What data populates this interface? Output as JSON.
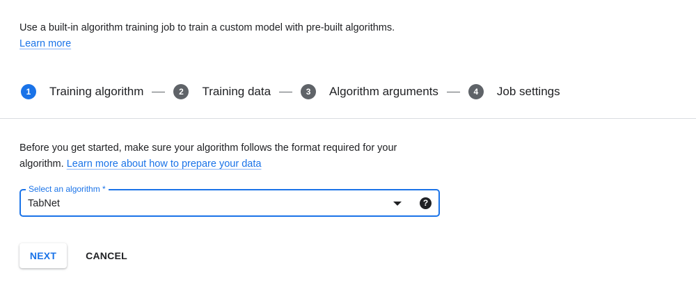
{
  "intro": {
    "text": "Use a built-in algorithm training job to train a custom model with pre-built algorithms.",
    "link": "Learn more"
  },
  "stepper": {
    "steps": [
      {
        "number": "1",
        "label": "Training algorithm",
        "active": true
      },
      {
        "number": "2",
        "label": "Training data",
        "active": false
      },
      {
        "number": "3",
        "label": "Algorithm arguments",
        "active": false
      },
      {
        "number": "4",
        "label": "Job settings",
        "active": false
      }
    ]
  },
  "description": {
    "text": "Before you get started, make sure your algorithm follows the format required for your algorithm.",
    "link": "Learn more about how to prepare your data"
  },
  "algorithm_select": {
    "label": "Select an algorithm *",
    "value": "TabNet",
    "dropdown_icon": "arrow-drop-down-icon",
    "help_icon": "help-icon",
    "help_glyph": "?"
  },
  "actions": {
    "next_label": "NEXT",
    "cancel_label": "CANCEL"
  },
  "colors": {
    "accent": "#1a73e8",
    "step_inactive": "#5f6368",
    "divider": "#dadce0",
    "text": "#202124"
  }
}
